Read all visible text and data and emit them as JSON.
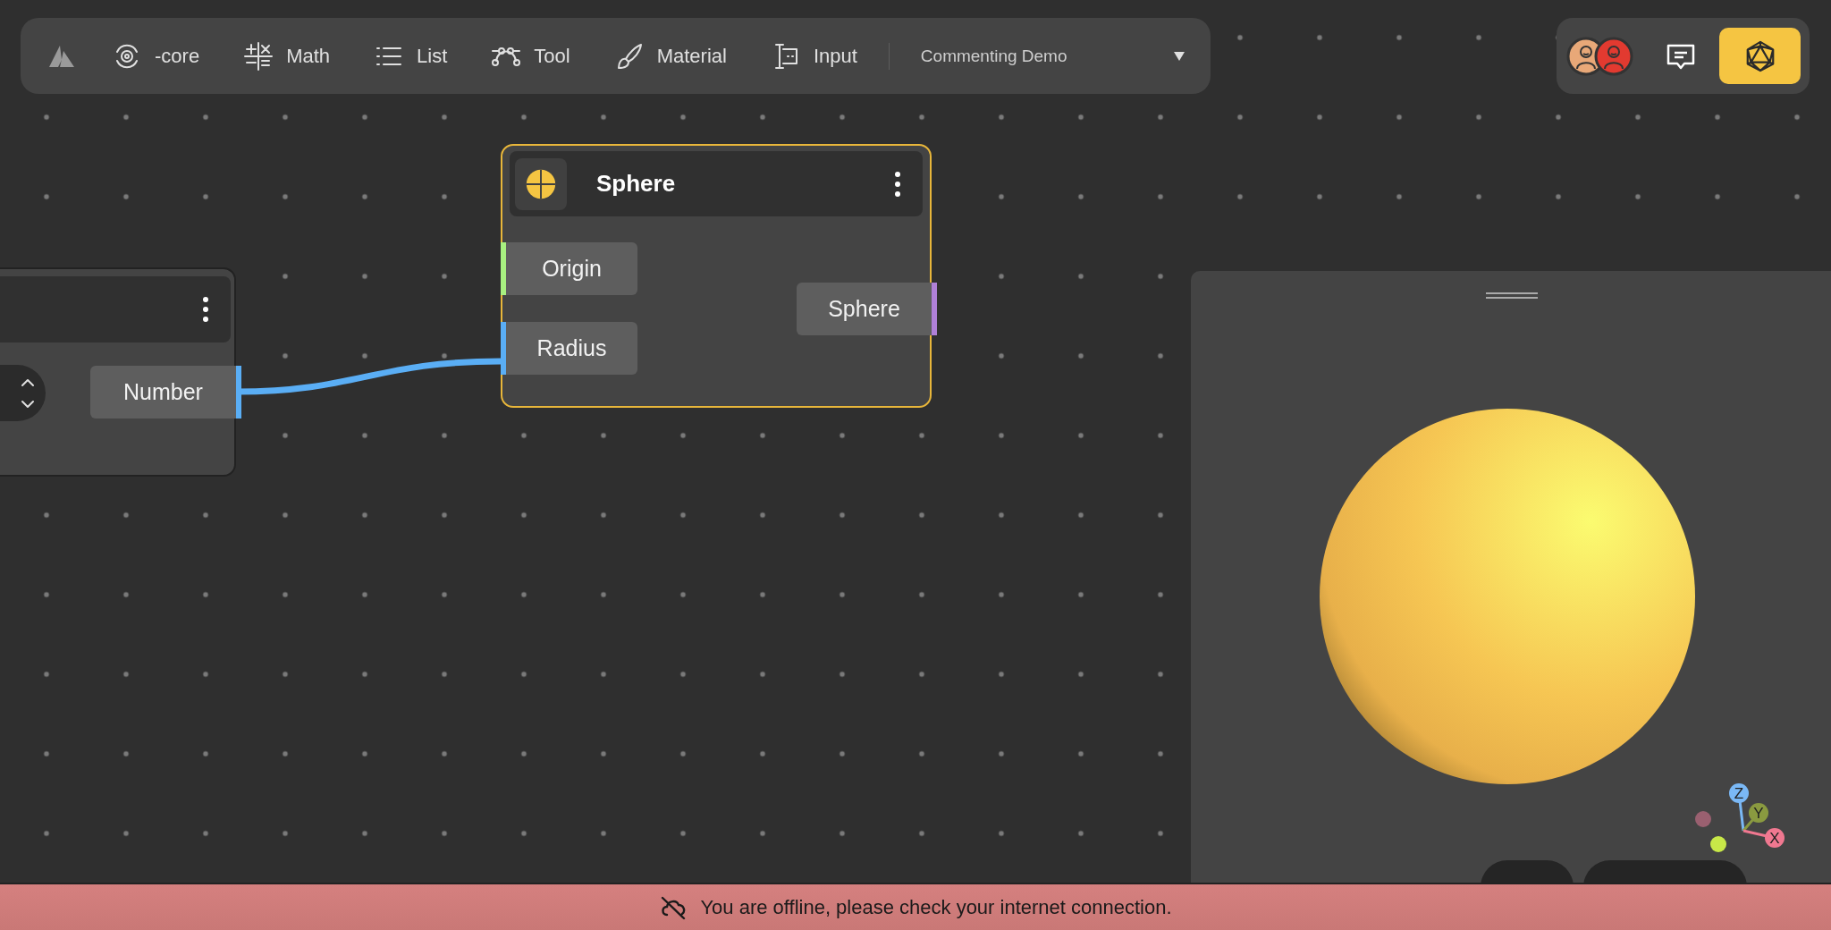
{
  "toolbar": {
    "items": [
      {
        "label": "-core"
      },
      {
        "label": "Math"
      },
      {
        "label": "List"
      },
      {
        "label": "Tool"
      },
      {
        "label": "Material"
      },
      {
        "label": "Input"
      }
    ],
    "project": {
      "title": "Commenting Demo"
    }
  },
  "collaborators": [
    {
      "color": "#e8a878"
    },
    {
      "color": "#e23a30"
    }
  ],
  "nodes": [
    {
      "selected": false,
      "outputs": [
        {
          "label": "Number",
          "color": "#5aaef5"
        }
      ]
    },
    {
      "title": "Sphere",
      "selected": true,
      "inputs": [
        {
          "label": "Origin",
          "color": "#a8f080"
        },
        {
          "label": "Radius",
          "color": "#5aaef5"
        }
      ],
      "outputs": [
        {
          "label": "Sphere",
          "color": "#b080d8"
        }
      ]
    }
  ],
  "gizmo": {
    "axes": [
      {
        "label": "Z",
        "color": "#7ab8f5"
      },
      {
        "label": "Y",
        "color": "#8a9a40"
      },
      {
        "label": "X",
        "color": "#f07890"
      }
    ]
  },
  "offline_banner": {
    "message": "You are offline, please check your internet connection."
  }
}
